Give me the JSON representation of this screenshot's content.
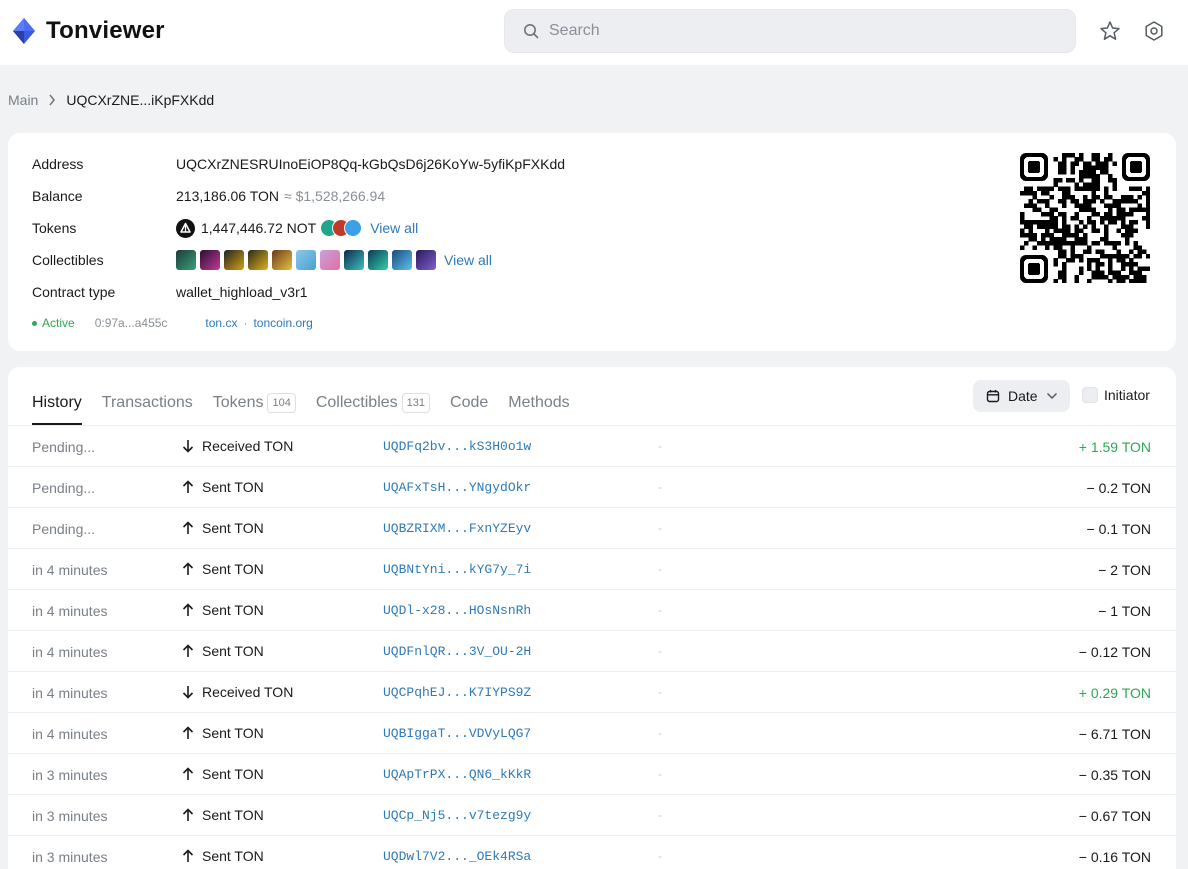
{
  "header": {
    "brand": "Tonviewer",
    "search_placeholder": "Search"
  },
  "breadcrumb": {
    "main": "Main",
    "current": "UQCXrZNE...iKpFXKdd"
  },
  "info": {
    "address_label": "Address",
    "address": "UQCXrZNESRUInoEiOP8Qq-kGbQsD6j26KoYw-5yfiKpFXKdd",
    "balance_label": "Balance",
    "balance": "213,186.06 TON",
    "balance_usd": "≈ $1,528,266.94",
    "tokens_label": "Tokens",
    "tokens_value": "1,447,446.72 NOT",
    "tokens_view_all": "View all",
    "collectibles_label": "Collectibles",
    "collectibles_view_all": "View all",
    "contract_label": "Contract type",
    "contract_type": "wallet_highload_v3r1",
    "status": "Active",
    "code_hash": "0:97a...a455c",
    "ext_link_1": "ton.cx",
    "ext_sep": "·",
    "ext_link_2": "toncoin.org",
    "colors": {
      "active": "#2fa84f",
      "link": "#2d7ab8"
    }
  },
  "tabs": [
    {
      "label": "History",
      "count": ""
    },
    {
      "label": "Transactions",
      "count": ""
    },
    {
      "label": "Tokens",
      "count": "104"
    },
    {
      "label": "Collectibles",
      "count": "131"
    },
    {
      "label": "Code",
      "count": ""
    },
    {
      "label": "Methods",
      "count": ""
    }
  ],
  "filters": {
    "date_label": "Date",
    "initiator_label": "Initiator"
  },
  "history": [
    {
      "time": "Pending...",
      "direction": "in",
      "type": "Received TON",
      "address": "UQDFq2bv...kS3H0o1w",
      "dash": "-",
      "amount": "+ 1.59 TON"
    },
    {
      "time": "Pending...",
      "direction": "out",
      "type": "Sent TON",
      "address": "UQAFxTsH...YNgydOkr",
      "dash": "-",
      "amount": "− 0.2 TON"
    },
    {
      "time": "Pending...",
      "direction": "out",
      "type": "Sent TON",
      "address": "UQBZRIXM...FxnYZEyv",
      "dash": "-",
      "amount": "− 0.1 TON"
    },
    {
      "time": "in 4 minutes",
      "direction": "out",
      "type": "Sent TON",
      "address": "UQBNtYni...kYG7y_7i",
      "dash": "-",
      "amount": "− 2 TON"
    },
    {
      "time": "in 4 minutes",
      "direction": "out",
      "type": "Sent TON",
      "address": "UQDl-x28...HOsNsnRh",
      "dash": "-",
      "amount": "− 1 TON"
    },
    {
      "time": "in 4 minutes",
      "direction": "out",
      "type": "Sent TON",
      "address": "UQDFnlQR...3V_OU-2H",
      "dash": "-",
      "amount": "− 0.12 TON"
    },
    {
      "time": "in 4 minutes",
      "direction": "in",
      "type": "Received TON",
      "address": "UQCPqhEJ...K7IYPS9Z",
      "dash": "-",
      "amount": "+ 0.29 TON"
    },
    {
      "time": "in 4 minutes",
      "direction": "out",
      "type": "Sent TON",
      "address": "UQBIggaT...VDVyLQG7",
      "dash": "-",
      "amount": "− 6.71 TON"
    },
    {
      "time": "in 3 minutes",
      "direction": "out",
      "type": "Sent TON",
      "address": "UQApTrPX...QN6_kKkR",
      "dash": "-",
      "amount": "− 0.35 TON"
    },
    {
      "time": "in 3 minutes",
      "direction": "out",
      "type": "Sent TON",
      "address": "UQCp_Nj5...v7tezg9y",
      "dash": "-",
      "amount": "− 0.67 TON"
    },
    {
      "time": "in 3 minutes",
      "direction": "out",
      "type": "Sent TON",
      "address": "UQDwl7V2..._OEk4RSa",
      "dash": "-",
      "amount": "− 0.16 TON"
    }
  ]
}
